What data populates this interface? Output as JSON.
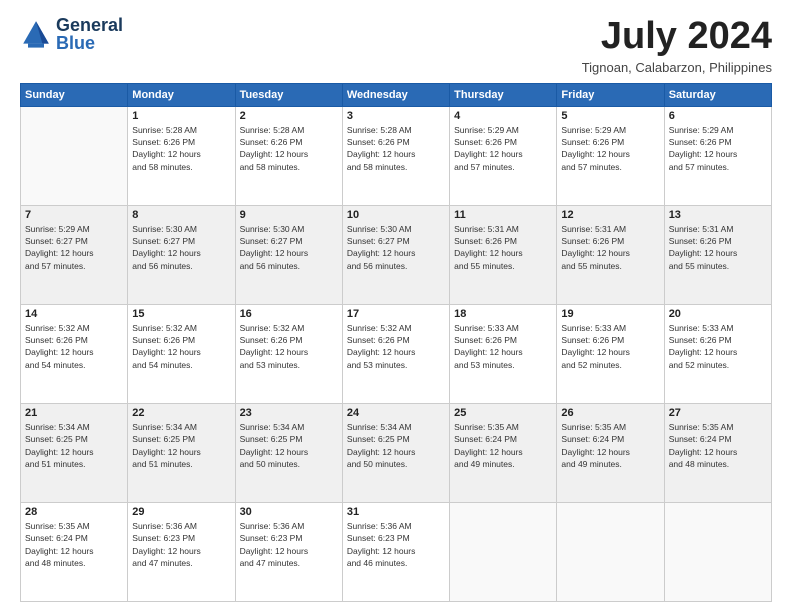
{
  "logo": {
    "text_general": "General",
    "text_blue": "Blue"
  },
  "title": "July 2024",
  "location": "Tignoan, Calabarzon, Philippines",
  "days_of_week": [
    "Sunday",
    "Monday",
    "Tuesday",
    "Wednesday",
    "Thursday",
    "Friday",
    "Saturday"
  ],
  "weeks": [
    [
      {
        "day": "",
        "info": ""
      },
      {
        "day": "1",
        "info": "Sunrise: 5:28 AM\nSunset: 6:26 PM\nDaylight: 12 hours\nand 58 minutes."
      },
      {
        "day": "2",
        "info": "Sunrise: 5:28 AM\nSunset: 6:26 PM\nDaylight: 12 hours\nand 58 minutes."
      },
      {
        "day": "3",
        "info": "Sunrise: 5:28 AM\nSunset: 6:26 PM\nDaylight: 12 hours\nand 58 minutes."
      },
      {
        "day": "4",
        "info": "Sunrise: 5:29 AM\nSunset: 6:26 PM\nDaylight: 12 hours\nand 57 minutes."
      },
      {
        "day": "5",
        "info": "Sunrise: 5:29 AM\nSunset: 6:26 PM\nDaylight: 12 hours\nand 57 minutes."
      },
      {
        "day": "6",
        "info": "Sunrise: 5:29 AM\nSunset: 6:26 PM\nDaylight: 12 hours\nand 57 minutes."
      }
    ],
    [
      {
        "day": "7",
        "info": "Sunrise: 5:29 AM\nSunset: 6:27 PM\nDaylight: 12 hours\nand 57 minutes."
      },
      {
        "day": "8",
        "info": "Sunrise: 5:30 AM\nSunset: 6:27 PM\nDaylight: 12 hours\nand 56 minutes."
      },
      {
        "day": "9",
        "info": "Sunrise: 5:30 AM\nSunset: 6:27 PM\nDaylight: 12 hours\nand 56 minutes."
      },
      {
        "day": "10",
        "info": "Sunrise: 5:30 AM\nSunset: 6:27 PM\nDaylight: 12 hours\nand 56 minutes."
      },
      {
        "day": "11",
        "info": "Sunrise: 5:31 AM\nSunset: 6:26 PM\nDaylight: 12 hours\nand 55 minutes."
      },
      {
        "day": "12",
        "info": "Sunrise: 5:31 AM\nSunset: 6:26 PM\nDaylight: 12 hours\nand 55 minutes."
      },
      {
        "day": "13",
        "info": "Sunrise: 5:31 AM\nSunset: 6:26 PM\nDaylight: 12 hours\nand 55 minutes."
      }
    ],
    [
      {
        "day": "14",
        "info": "Sunrise: 5:32 AM\nSunset: 6:26 PM\nDaylight: 12 hours\nand 54 minutes."
      },
      {
        "day": "15",
        "info": "Sunrise: 5:32 AM\nSunset: 6:26 PM\nDaylight: 12 hours\nand 54 minutes."
      },
      {
        "day": "16",
        "info": "Sunrise: 5:32 AM\nSunset: 6:26 PM\nDaylight: 12 hours\nand 53 minutes."
      },
      {
        "day": "17",
        "info": "Sunrise: 5:32 AM\nSunset: 6:26 PM\nDaylight: 12 hours\nand 53 minutes."
      },
      {
        "day": "18",
        "info": "Sunrise: 5:33 AM\nSunset: 6:26 PM\nDaylight: 12 hours\nand 53 minutes."
      },
      {
        "day": "19",
        "info": "Sunrise: 5:33 AM\nSunset: 6:26 PM\nDaylight: 12 hours\nand 52 minutes."
      },
      {
        "day": "20",
        "info": "Sunrise: 5:33 AM\nSunset: 6:26 PM\nDaylight: 12 hours\nand 52 minutes."
      }
    ],
    [
      {
        "day": "21",
        "info": "Sunrise: 5:34 AM\nSunset: 6:25 PM\nDaylight: 12 hours\nand 51 minutes."
      },
      {
        "day": "22",
        "info": "Sunrise: 5:34 AM\nSunset: 6:25 PM\nDaylight: 12 hours\nand 51 minutes."
      },
      {
        "day": "23",
        "info": "Sunrise: 5:34 AM\nSunset: 6:25 PM\nDaylight: 12 hours\nand 50 minutes."
      },
      {
        "day": "24",
        "info": "Sunrise: 5:34 AM\nSunset: 6:25 PM\nDaylight: 12 hours\nand 50 minutes."
      },
      {
        "day": "25",
        "info": "Sunrise: 5:35 AM\nSunset: 6:24 PM\nDaylight: 12 hours\nand 49 minutes."
      },
      {
        "day": "26",
        "info": "Sunrise: 5:35 AM\nSunset: 6:24 PM\nDaylight: 12 hours\nand 49 minutes."
      },
      {
        "day": "27",
        "info": "Sunrise: 5:35 AM\nSunset: 6:24 PM\nDaylight: 12 hours\nand 48 minutes."
      }
    ],
    [
      {
        "day": "28",
        "info": "Sunrise: 5:35 AM\nSunset: 6:24 PM\nDaylight: 12 hours\nand 48 minutes."
      },
      {
        "day": "29",
        "info": "Sunrise: 5:36 AM\nSunset: 6:23 PM\nDaylight: 12 hours\nand 47 minutes."
      },
      {
        "day": "30",
        "info": "Sunrise: 5:36 AM\nSunset: 6:23 PM\nDaylight: 12 hours\nand 47 minutes."
      },
      {
        "day": "31",
        "info": "Sunrise: 5:36 AM\nSunset: 6:23 PM\nDaylight: 12 hours\nand 46 minutes."
      },
      {
        "day": "",
        "info": ""
      },
      {
        "day": "",
        "info": ""
      },
      {
        "day": "",
        "info": ""
      }
    ]
  ]
}
